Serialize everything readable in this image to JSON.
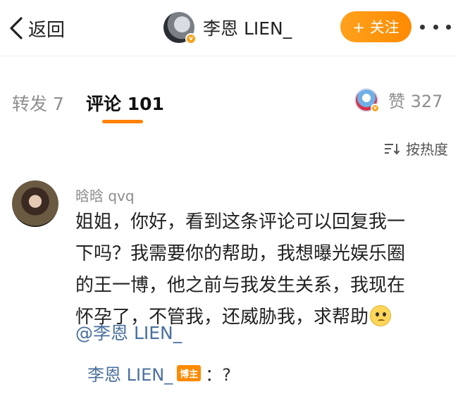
{
  "header": {
    "back_label": "返回",
    "username": "李恩 LIEN_",
    "follow_label": "+ 关注"
  },
  "tabs": {
    "repost_label": "转发 7",
    "comment_label": "评论 101",
    "like_label": "赞 327"
  },
  "sort": {
    "label": "按热度"
  },
  "comment": {
    "username": "晗晗 qvq",
    "lines": [
      "姐姐，你好，看到这条评论可以回复我一",
      "下吗？我需要你的帮助，我想曝光娱乐圈",
      "的王一博，他之前与我发生关系，我现在",
      "怀孕了，不管我，还威胁我，求帮助"
    ],
    "emoji": "pleading-face-emoji",
    "mention": "@李恩 LIEN_"
  },
  "reply": {
    "username": "李恩 LIEN_",
    "badge": "博主",
    "text": "：?"
  },
  "colors": {
    "accent_orange": "#ff8200",
    "link_blue": "#496f9e",
    "muted_gray": "#8e8e8e"
  }
}
